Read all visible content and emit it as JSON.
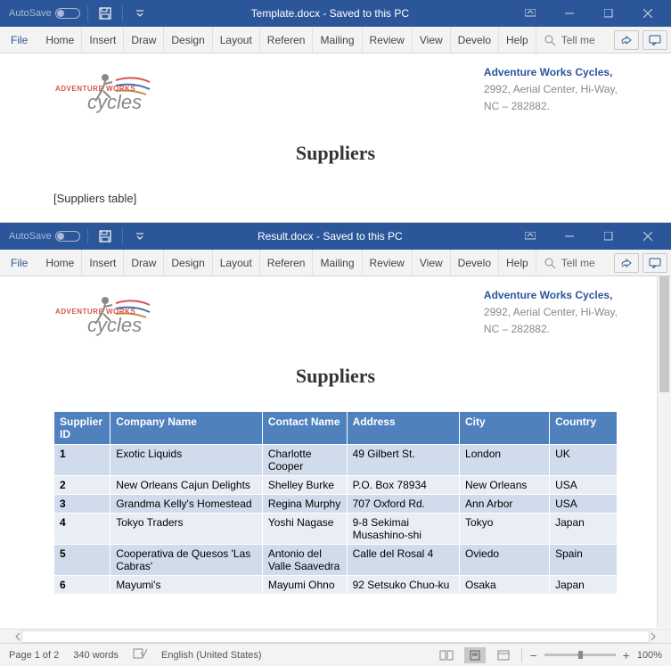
{
  "win1": {
    "autosave": "AutoSave",
    "title": "Template.docx  -  Saved to this PC",
    "tabs": [
      "File",
      "Home",
      "Insert",
      "Draw",
      "Design",
      "Layout",
      "Referen",
      "Mailing",
      "Review",
      "View",
      "Develo",
      "Help"
    ],
    "tellme": "Tell me",
    "company": {
      "logo_top": "ADVENTURE WORKS",
      "logo_bottom": "cycles",
      "name": "Adventure Works Cycles,",
      "addr1": "2992, Aerial Center, Hi-Way,",
      "addr2": "NC – 282882."
    },
    "heading": "Suppliers",
    "placeholder": "[Suppliers table]"
  },
  "win2": {
    "autosave": "AutoSave",
    "title": "Result.docx  -  Saved to this PC",
    "tabs": [
      "File",
      "Home",
      "Insert",
      "Draw",
      "Design",
      "Layout",
      "Referen",
      "Mailing",
      "Review",
      "View",
      "Develo",
      "Help"
    ],
    "tellme": "Tell me",
    "company": {
      "name": "Adventure Works Cycles,",
      "addr1": "2992, Aerial Center, Hi-Way,",
      "addr2": "NC – 282882."
    },
    "heading": "Suppliers",
    "table": {
      "headers": [
        "Supplier ID",
        "Company Name",
        "Contact Name",
        "Address",
        "City",
        "Country"
      ],
      "rows": [
        [
          "1",
          "Exotic Liquids",
          "Charlotte Cooper",
          "49 Gilbert St.",
          "London",
          "UK"
        ],
        [
          "2",
          "New Orleans Cajun Delights",
          "Shelley Burke",
          "P.O. Box 78934",
          "New Orleans",
          "USA"
        ],
        [
          "3",
          "Grandma Kelly's Homestead",
          "Regina Murphy",
          "707 Oxford Rd.",
          "Ann Arbor",
          "USA"
        ],
        [
          "4",
          "Tokyo Traders",
          "Yoshi Nagase",
          "9-8 Sekimai Musashino-shi",
          "Tokyo",
          "Japan"
        ],
        [
          "5",
          "Cooperativa de Quesos 'Las Cabras'",
          "Antonio del Valle Saavedra",
          "Calle del Rosal 4",
          "Oviedo",
          "Spain"
        ],
        [
          "6",
          "Mayumi's",
          "Mayumi Ohno",
          "92 Setsuko Chuo-ku",
          "Osaka",
          "Japan"
        ]
      ]
    },
    "status": {
      "page": "Page 1 of 2",
      "words": "340 words",
      "lang": "English (United States)",
      "zoom": "100%"
    }
  }
}
